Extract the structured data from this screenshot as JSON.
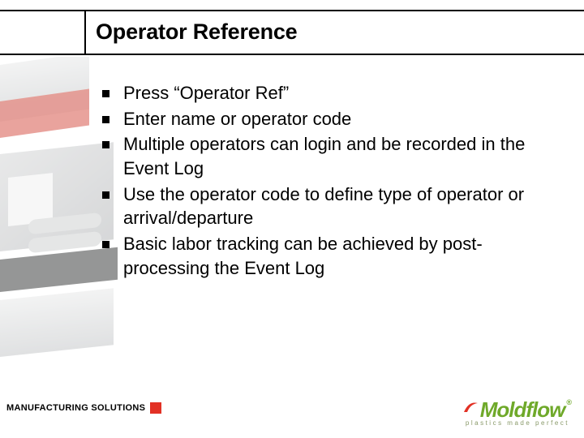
{
  "title": "Operator Reference",
  "bullets": [
    "Press “Operator Ref”",
    "Enter name or operator code",
    "Multiple operators can login and be recorded in the Event Log",
    "Use the operator code to define type of operator or arrival/departure",
    "Basic labor tracking can be achieved by post-processing the Event Log"
  ],
  "footer_label": "MANUFACTURING SOLUTIONS",
  "brand": {
    "name": "Moldflow",
    "tagline": "plastics made perfect",
    "registered": "®"
  }
}
